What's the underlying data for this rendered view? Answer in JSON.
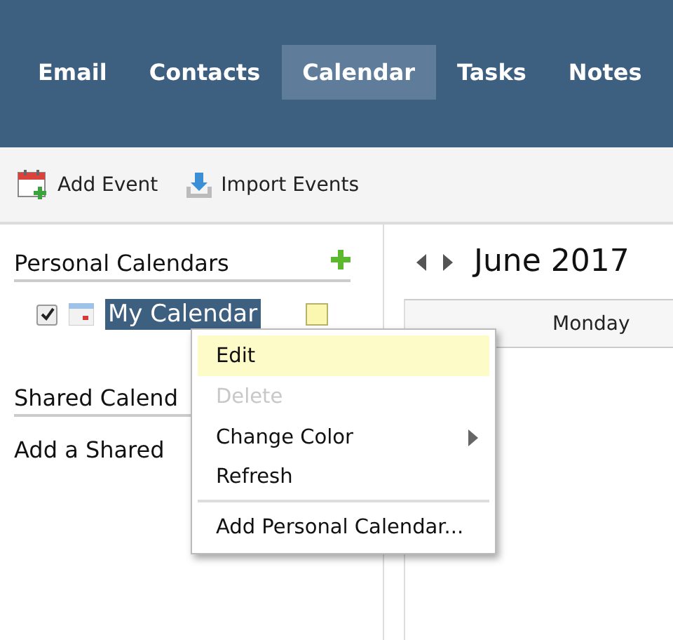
{
  "nav": {
    "tabs": [
      {
        "label": "Email",
        "selected": false
      },
      {
        "label": "Contacts",
        "selected": false
      },
      {
        "label": "Calendar",
        "selected": true
      },
      {
        "label": "Tasks",
        "selected": false
      },
      {
        "label": "Notes",
        "selected": false
      }
    ]
  },
  "toolbar": {
    "buttons": [
      {
        "label": "Add Event",
        "kind": "add"
      },
      {
        "label": "Import Events",
        "kind": "import"
      }
    ]
  },
  "sidebar": {
    "personal_heading": "Personal Calendars",
    "calendars": [
      {
        "name": "My Calendar",
        "checked": true,
        "selected": true,
        "color": "#fbf7b0"
      }
    ],
    "shared_heading": "Shared Calend",
    "shared_link": "Add a Shared"
  },
  "calendar": {
    "title": "June 2017",
    "columns": [
      "Monday"
    ]
  },
  "context_menu": {
    "items": [
      {
        "label": "Edit",
        "selected": true,
        "disabled": false,
        "submenu": false
      },
      {
        "label": "Delete",
        "selected": false,
        "disabled": true,
        "submenu": false
      },
      {
        "label": "Change Color",
        "selected": false,
        "disabled": false,
        "submenu": true
      },
      {
        "label": "Refresh",
        "selected": false,
        "disabled": false,
        "submenu": false,
        "divider_after": true
      },
      {
        "label": "Add Personal Calendar...",
        "selected": false,
        "disabled": false,
        "submenu": false
      }
    ]
  }
}
